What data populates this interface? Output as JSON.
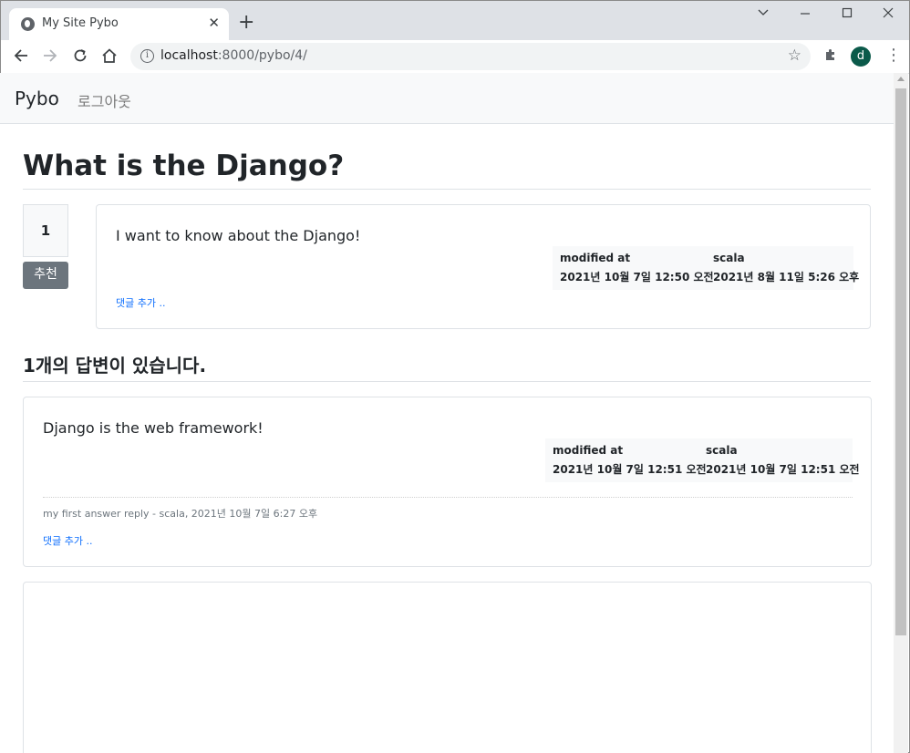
{
  "browser": {
    "tab_title": "My Site Pybo",
    "tab_close": "✕",
    "new_tab": "+",
    "url_host": "localhost",
    "url_rest": ":8000/pybo/4/",
    "profile_initial": "d"
  },
  "navbar": {
    "brand": "Pybo",
    "logout": "로그아웃"
  },
  "question": {
    "title": "What is the Django?",
    "vote_count": "1",
    "vote_button": "추천",
    "content": "I want to know about the Django!",
    "modified_label": "modified at",
    "modified_value": "2021년 10월 7일 12:50 오전",
    "author_label": "scala",
    "author_value": "2021년 8월 11일 5:26 오후",
    "add_comment": "댓글 추가 .."
  },
  "answers": {
    "count_prefix": "1",
    "count_text": "개의 답변이 있습니다.",
    "items": [
      {
        "content": "Django is the web framework!",
        "modified_label": "modified at",
        "modified_value": "2021년 10월 7일 12:51 오전",
        "author_label": "scala",
        "author_value": "2021년 10월 7일 12:51 오전",
        "comment": "my first answer reply - scala, 2021년 10월 7일 6:27 오후",
        "add_comment": "댓글 추가 .."
      }
    ]
  },
  "colors": {
    "vote_button_bg": "#6c757d",
    "link": "#0d6efd"
  }
}
